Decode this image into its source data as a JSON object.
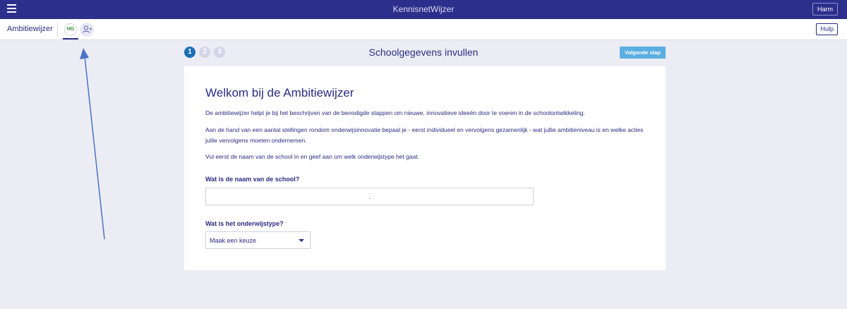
{
  "topbar": {
    "title": "KennisnetWijzer",
    "user_label": "Harm"
  },
  "subbar": {
    "app_name": "Ambitiewijzer",
    "avatar_initials": "HG",
    "help_label": "Hulp"
  },
  "steps": [
    "1",
    "2",
    "3"
  ],
  "header": {
    "heading": "Schoolgegevens invullen",
    "next_label": "Volgende stap"
  },
  "card": {
    "title": "Welkom bij de Ambitiewijzer",
    "paragraph_1": "De ambitiewijzer helpt je bij het beschrijven van de benodigde stappen om nieuwe, innovatieve ideeën door te voeren in de schoolontwikkeling.",
    "paragraph_2": "Aan de hand van een aantal stellingen rondom onderwijsinnovatie bepaal je - eerst individueel en vervolgens gezamenlijk - wat jullie ambitieniveau is en welke acties jullie vervolgens moeten ondernemen.",
    "paragraph_3": "Vul eerst de naam van de school in en geef aan om welk onderwijstype het gaat.",
    "school_label": "Wat is de naam van de school?",
    "school_value": ".",
    "type_label": "Wat is het onderwijstype?",
    "type_selected": "Maak een keuze"
  },
  "colors": {
    "topbar": "#2d2f8c",
    "accent": "#1a6fb5",
    "next_button": "#5aaee0",
    "text": "#2a2c82",
    "background": "#ecedf4",
    "annotation_arrow": "#4a72c8"
  },
  "icons": {
    "menu": "hamburger-icon",
    "add_user": "add-user-icon",
    "dropdown": "caret-down-icon"
  }
}
